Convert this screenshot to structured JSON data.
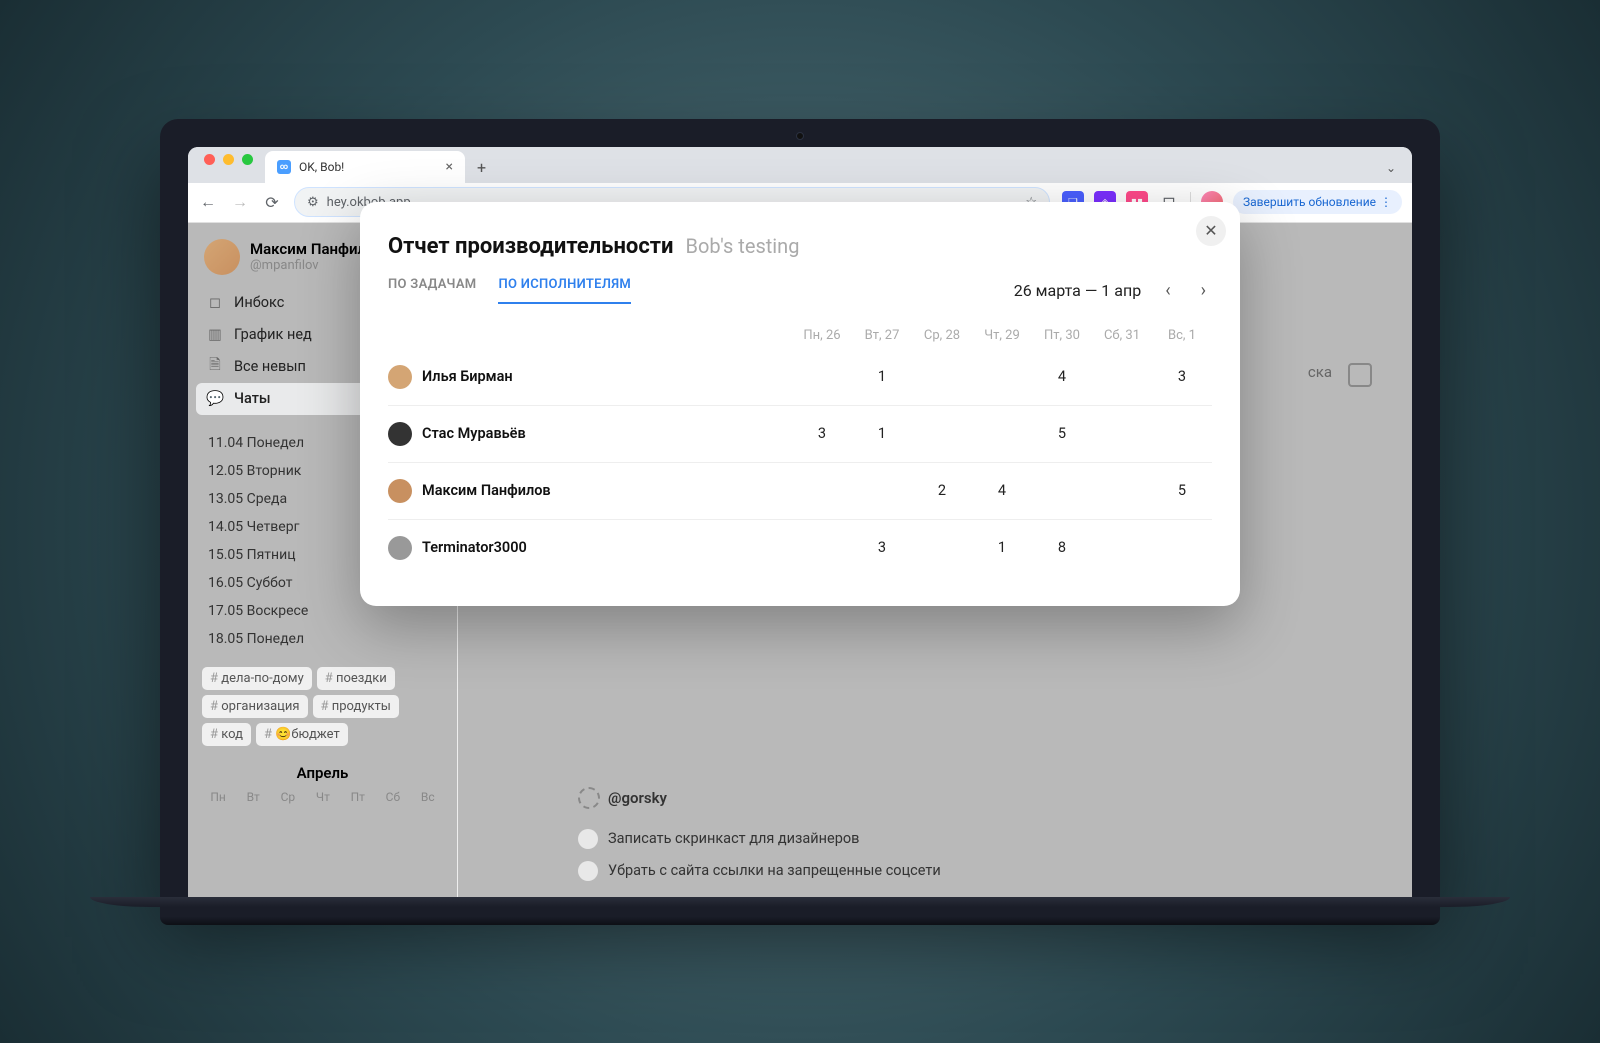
{
  "browser": {
    "tab_title": "OK, Bob!",
    "url": "hey.okbob.app",
    "update_button": "Завершить обновление"
  },
  "sidebar": {
    "user_name": "Максим Панфилов",
    "user_handle": "@mpanfilov",
    "nav": {
      "inbox": "Инбокс",
      "schedule": "График нед",
      "overdue": "Все невып",
      "chats": "Чаты"
    },
    "dates": [
      "11.04 Понедел",
      "12.05 Вторник",
      "13.05 Среда",
      "14.05 Четверг",
      "15.05 Пятниц",
      "16.05 Суббот",
      "17.05 Воскресе",
      "18.05 Понедел"
    ],
    "tags": [
      "дела-по-дому",
      "поездки",
      "организация",
      "продукты",
      "код",
      "😊бюджет"
    ],
    "month": "Апрель",
    "weekdays_short": [
      "Пн",
      "Вт",
      "Ср",
      "Чт",
      "Пт",
      "Сб",
      "Вс"
    ]
  },
  "background": {
    "board_label_partial": "ска",
    "handle": "@gorsky",
    "tasks": [
      "Записать скринкаст для дизайнеров",
      "Убрать с сайта ссылки на запрещенные соцсети"
    ]
  },
  "modal": {
    "title": "Отчет производительности",
    "subtitle": "Bob's testing",
    "tabs": {
      "by_tasks": "ПО ЗАДАЧАМ",
      "by_assignees": "ПО ИСПОЛНИТЕЛЯМ"
    },
    "date_range": "26 марта — 1 апр",
    "columns": [
      "Пн, 26",
      "Вт, 27",
      "Ср, 28",
      "Чт, 29",
      "Пт, 30",
      "Сб, 31",
      "Вс, 1"
    ],
    "rows": [
      {
        "name": "Илья Бирман",
        "vals": [
          "",
          "1",
          "",
          "",
          "4",
          "",
          "3"
        ]
      },
      {
        "name": "Стас Муравьёв",
        "vals": [
          "3",
          "1",
          "",
          "",
          "5",
          "",
          ""
        ]
      },
      {
        "name": "Максим Панфилов",
        "vals": [
          "",
          "",
          "2",
          "4",
          "",
          "",
          "5"
        ]
      },
      {
        "name": "Terminator3000",
        "vals": [
          "",
          "3",
          "",
          "1",
          "8",
          "",
          ""
        ]
      }
    ]
  },
  "chart_data": {
    "type": "table",
    "title": "Отчет производительности — Bob's testing",
    "columns": [
      "Пн, 26",
      "Вт, 27",
      "Ср, 28",
      "Чт, 29",
      "Пт, 30",
      "Сб, 31",
      "Вс, 1"
    ],
    "series": [
      {
        "name": "Илья Бирман",
        "values": [
          null,
          1,
          null,
          null,
          4,
          null,
          3
        ]
      },
      {
        "name": "Стас Муравьёв",
        "values": [
          3,
          1,
          null,
          null,
          5,
          null,
          null
        ]
      },
      {
        "name": "Максим Панфилов",
        "values": [
          null,
          null,
          2,
          4,
          null,
          null,
          5
        ]
      },
      {
        "name": "Terminator3000",
        "values": [
          null,
          3,
          null,
          1,
          8,
          null,
          null
        ]
      }
    ]
  }
}
